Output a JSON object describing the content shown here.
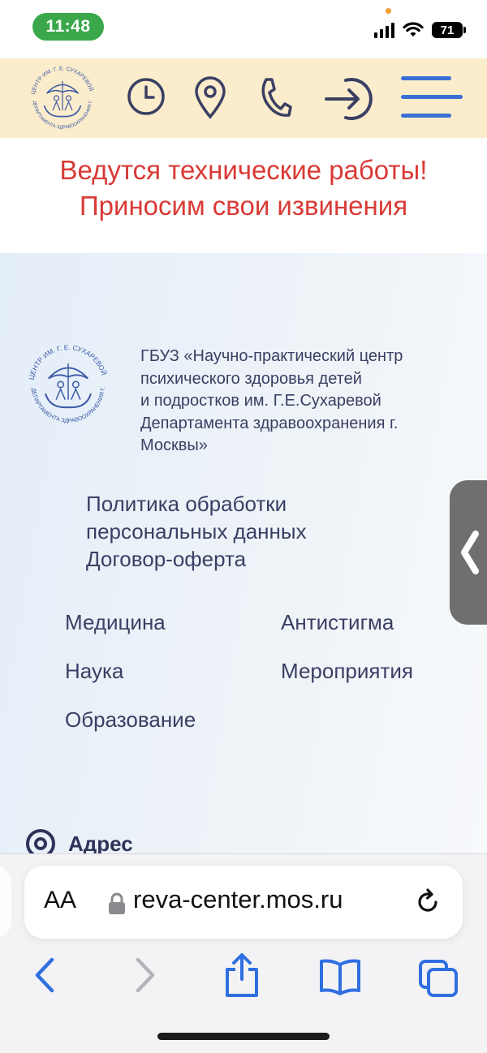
{
  "status": {
    "time": "11:48",
    "battery": "71"
  },
  "header": {
    "icons": [
      "clock-icon",
      "map-pin-icon",
      "phone-icon",
      "login-arrow-icon",
      "hamburger-menu-icon"
    ]
  },
  "notice": {
    "line1": "Ведутся технические работы!",
    "line2": "Приносим свои извинения"
  },
  "logo": {
    "ring_text": "ЦЕНТР ИМ. Г. Е. СУХАРЕВОЙ ДЕПАРТАМЕНТА ЗДРАВООХРАНЕНИЯ Г. МОСКВЫ"
  },
  "org": {
    "lines": [
      "ГБУЗ «Научно-практический центр",
      "психического здоровья детей",
      "и подростков им. Г.Е.Сухаревой",
      "Департамента здравоохранения г.",
      "Москвы»"
    ]
  },
  "policy": {
    "line1": "Политика обработки",
    "line2": "персональных данных",
    "offer": "Договор-оферта"
  },
  "menu": {
    "left": [
      "Медицина",
      "Наука",
      "Образование"
    ],
    "right": [
      "Антистигма",
      "Мероприятия"
    ]
  },
  "address": {
    "label": "Адрес"
  },
  "browser": {
    "aa_label": "AA",
    "url": "reva-center.mos.ru"
  },
  "colors": {
    "header_bg": "#fbeccb",
    "notice_red": "#d93a35",
    "text_navy": "#3a3f63",
    "ios_blue": "#2f6fe0"
  }
}
